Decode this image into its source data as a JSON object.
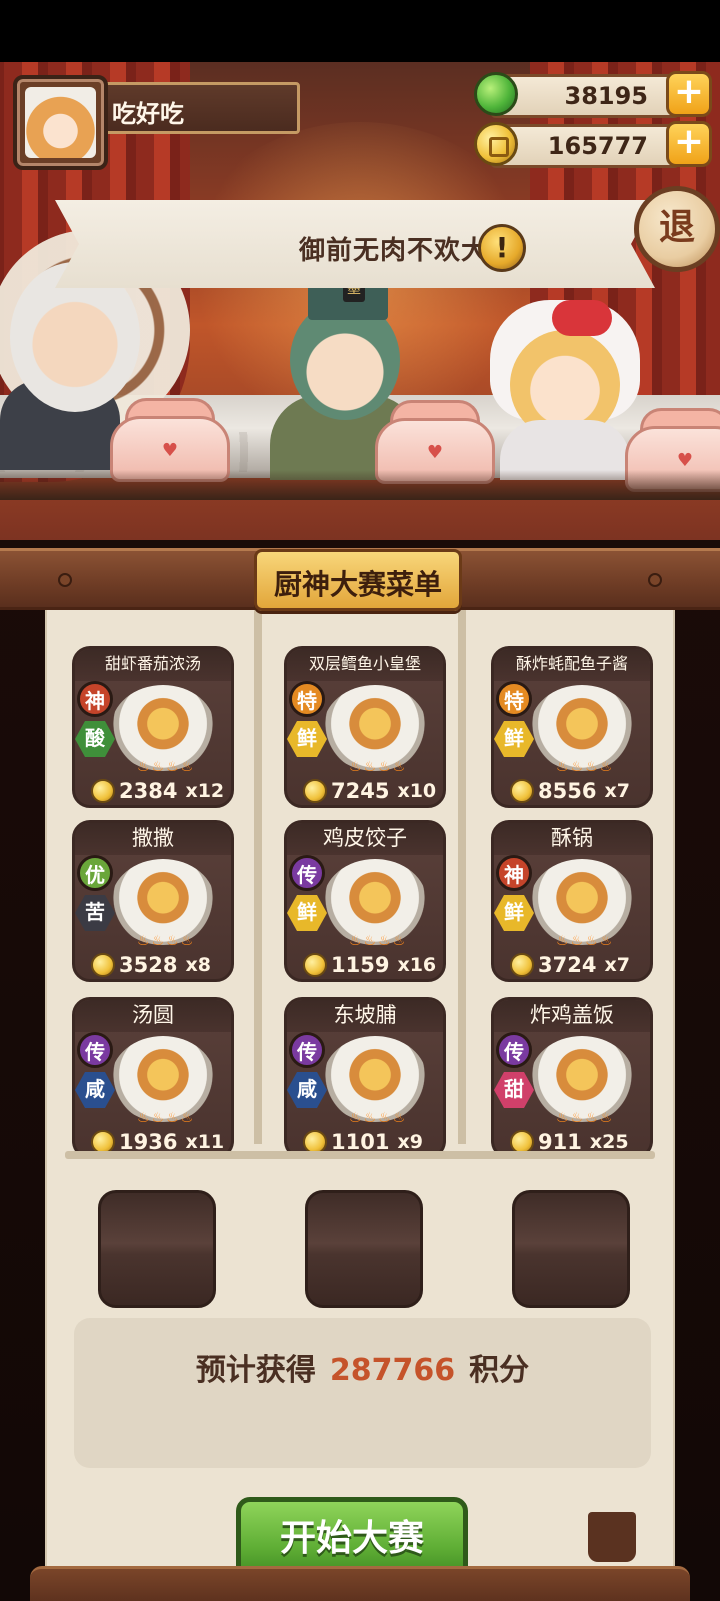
{
  "user": {
    "name": "吃好吃"
  },
  "currency": {
    "gems": "38195",
    "coins": "165777",
    "add_label": "+"
  },
  "event": {
    "title": "御前无肉不欢大赛",
    "alert_label": "!"
  },
  "exit_label": "退",
  "character": {
    "hat_tag": "墨"
  },
  "menu": {
    "title": "厨神大赛菜单",
    "dishes": [
      {
        "name": "甜虾番茄浓汤",
        "rank": "神",
        "taste": "酸",
        "price": "2384",
        "qty": "x12",
        "rank_color": "#c5442a",
        "taste_color": "#3f8f3a"
      },
      {
        "name": "双层鳕鱼小皇堡",
        "rank": "特",
        "taste": "鲜",
        "price": "7245",
        "qty": "x10",
        "rank_color": "#e48a22",
        "taste_color": "#e8b82a"
      },
      {
        "name": "酥炸蚝配鱼子酱",
        "rank": "特",
        "taste": "鲜",
        "price": "8556",
        "qty": "x7",
        "rank_color": "#e48a22",
        "taste_color": "#e8b82a"
      },
      {
        "name": "撒撒",
        "rank": "优",
        "taste": "苦",
        "price": "3528",
        "qty": "x8",
        "rank_color": "#6aa63a",
        "taste_color": "#3b3b44"
      },
      {
        "name": "鸡皮饺子",
        "rank": "传",
        "taste": "鲜",
        "price": "1159",
        "qty": "x16",
        "rank_color": "#7a3aa0",
        "taste_color": "#e8b82a"
      },
      {
        "name": "酥锅",
        "rank": "神",
        "taste": "鲜",
        "price": "3724",
        "qty": "x7",
        "rank_color": "#c5442a",
        "taste_color": "#e8b82a"
      },
      {
        "name": "汤圆",
        "rank": "传",
        "taste": "咸",
        "price": "1936",
        "qty": "x11",
        "rank_color": "#7a3aa0",
        "taste_color": "#2a4f8f"
      },
      {
        "name": "东坡脯",
        "rank": "传",
        "taste": "咸",
        "price": "1101",
        "qty": "x9",
        "rank_color": "#7a3aa0",
        "taste_color": "#2a4f8f"
      },
      {
        "name": "炸鸡盖饭",
        "rank": "传",
        "taste": "甜",
        "price": "911",
        "qty": "x25",
        "rank_color": "#7a3aa0",
        "taste_color": "#d0406a"
      }
    ]
  },
  "estimate": {
    "prefix": "预计获得",
    "value": "287766",
    "suffix": "积分"
  },
  "start_button": "开始大赛"
}
